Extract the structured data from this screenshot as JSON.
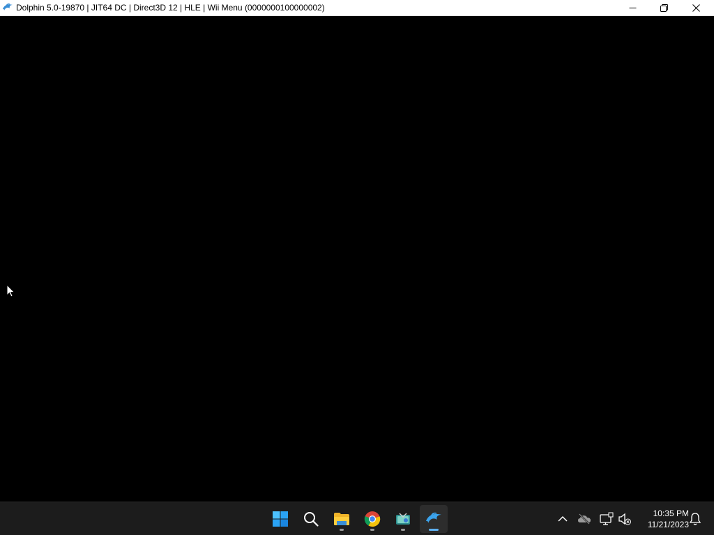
{
  "window": {
    "title": "Dolphin 5.0-19870 | JIT64 DC | Direct3D 12 | HLE | Wii Menu (0000000100000002)",
    "app_icon": "dolphin-icon",
    "controls": {
      "minimize_icon": "minimize-icon",
      "maximize_icon": "restore-icon",
      "close_icon": "close-icon"
    }
  },
  "render_area": {
    "background": "#000000"
  },
  "taskbar": {
    "apps": [
      {
        "name": "Start",
        "icon": "windows-start-icon",
        "running": false,
        "active": false
      },
      {
        "name": "Search",
        "icon": "search-icon",
        "running": false,
        "active": false
      },
      {
        "name": "File Explorer",
        "icon": "folder-icon",
        "running": true,
        "active": false
      },
      {
        "name": "Google Chrome",
        "icon": "chrome-icon",
        "running": true,
        "active": false
      },
      {
        "name": "Photos / Media",
        "icon": "media-app-icon",
        "running": true,
        "active": false
      },
      {
        "name": "Dolphin",
        "icon": "dolphin-icon",
        "running": true,
        "active": true
      }
    ],
    "tray": {
      "overflow_icon": "chevron-up-icon",
      "onedrive_icon": "cloud-offline-icon",
      "network_icon": "network-icon",
      "volume_icon": "volume-muted-icon",
      "notification_icon": "bell-icon"
    },
    "clock": {
      "time": "10:35 PM",
      "date": "11/21/2023"
    }
  },
  "colors": {
    "titlebar": "#ffffff",
    "taskbar": "#1c1c1c",
    "accent": "#5fb2f2"
  }
}
